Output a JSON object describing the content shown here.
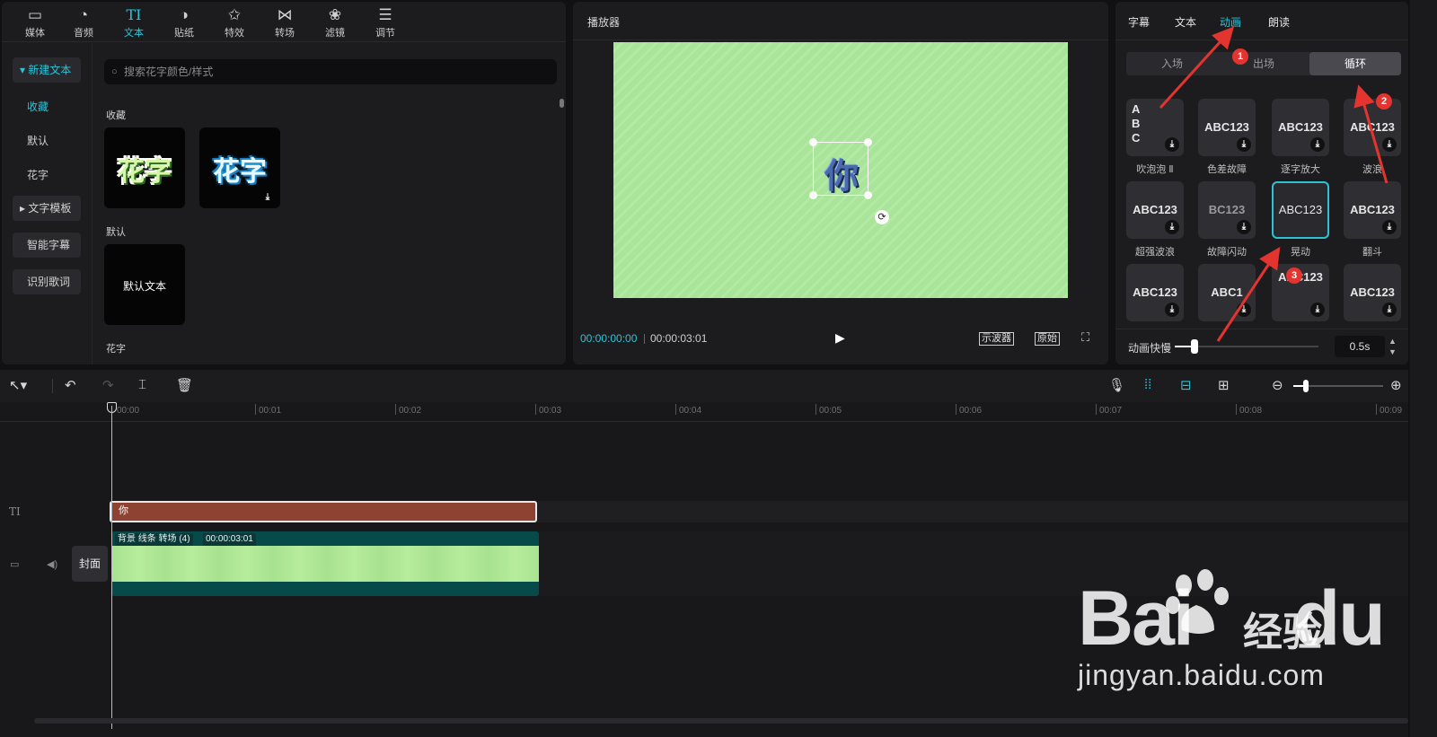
{
  "left_panel": {
    "tabs": [
      {
        "label": "媒体",
        "icon": "media-icon"
      },
      {
        "label": "音频",
        "icon": "audio-icon"
      },
      {
        "label": "文本",
        "icon": "text-icon",
        "active": true
      },
      {
        "label": "贴纸",
        "icon": "sticker-icon"
      },
      {
        "label": "特效",
        "icon": "effects-icon"
      },
      {
        "label": "转场",
        "icon": "transition-icon"
      },
      {
        "label": "滤镜",
        "icon": "filter-icon"
      },
      {
        "label": "调节",
        "icon": "adjust-icon"
      }
    ],
    "text_tab_glyph": "TI",
    "sidebar": {
      "new_text": "▾ 新建文本",
      "favorites": "收藏",
      "default": "默认",
      "fancy": "花字",
      "text_template": "▸ 文字模板",
      "smart_subtitle": "智能字幕",
      "lyrics": "识别歌词"
    },
    "search_placeholder": "搜索花字颜色/样式",
    "sections": {
      "favorites": "收藏",
      "default": "默认",
      "fancy": "花字"
    },
    "fancy_card_text": "花字",
    "default_card_text": "默认文本"
  },
  "player": {
    "title": "播放器",
    "preview_text": "你",
    "time_current": "00:00:00:00",
    "time_total": "00:00:03:01",
    "oscilloscope": "示波器",
    "original": "原始"
  },
  "right_panel": {
    "tabs": [
      "字幕",
      "文本",
      "动画",
      "朗读"
    ],
    "active_tab": "动画",
    "segments": [
      "入场",
      "出场",
      "循环"
    ],
    "active_segment": "循环",
    "tiles": [
      {
        "preview": "A B C",
        "label": "吹泡泡 Ⅱ"
      },
      {
        "preview": "ABC123",
        "label": "色差故障"
      },
      {
        "preview": "ABC123",
        "label": "逐字放大"
      },
      {
        "preview": "ABC123",
        "label": "波浪"
      },
      {
        "preview": "ABC123",
        "label": "超强波浪"
      },
      {
        "preview": "BC123",
        "label": "故障闪动"
      },
      {
        "preview": "ABC123",
        "label": "晃动",
        "selected": true
      },
      {
        "preview": "ABC123",
        "label": "翻斗"
      },
      {
        "preview": "ABC123",
        "label": ""
      },
      {
        "preview": "ABC1",
        "label": ""
      },
      {
        "preview": "ABC123",
        "label": ""
      },
      {
        "preview": "ABC123",
        "label": ""
      }
    ],
    "speed_label": "动画快慢",
    "speed_value": "0.5s",
    "speed_fraction": 0.14
  },
  "annotations": {
    "markers": [
      "1",
      "2",
      "3"
    ],
    "arrow_color": "#e3342f"
  },
  "timeline": {
    "ticks": [
      "00:00",
      "00:01",
      "00:02",
      "00:03",
      "00:04",
      "00:05",
      "00:06",
      "00:07",
      "00:08",
      "00:09"
    ],
    "text_clip_label": "你",
    "text_track_glyph": "TI",
    "video_clip_name": "背景 线条 转场 (4)",
    "video_clip_duration": "00:00:03:01",
    "cover_label": "封面",
    "zoom_fraction": 0.14
  },
  "watermark": {
    "logo": "Bai du",
    "cn": "经验",
    "url": "jingyan.baidu.com"
  },
  "colors": {
    "accent": "#2ec2d6",
    "text_clip": "#8e4332",
    "video_clip": "#064a4a",
    "canvas_green": "#a8e49a"
  }
}
